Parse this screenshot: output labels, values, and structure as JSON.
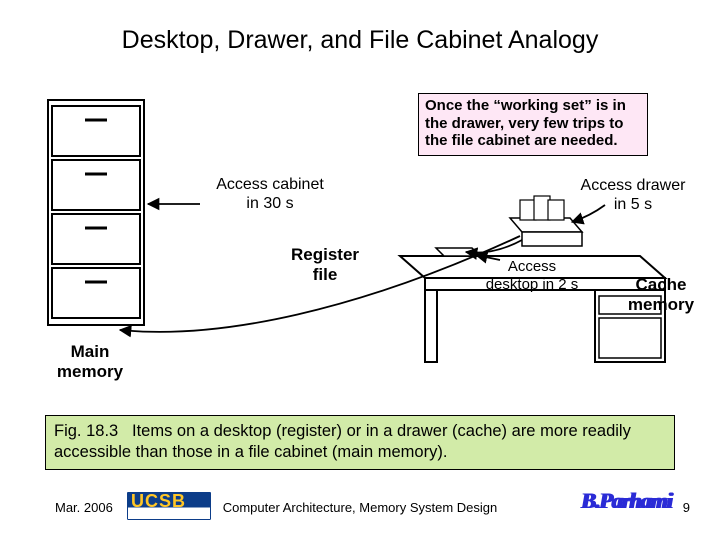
{
  "title": "Desktop, Drawer, and File Cabinet Analogy",
  "callout": "Once the “working set” is in the drawer, very few trips to the file cabinet are needed.",
  "labels": {
    "access_cabinet_l1": "Access cabinet",
    "access_cabinet_l2": "in 30 s",
    "access_drawer_l1": "Access drawer",
    "access_drawer_l2": "in 5 s",
    "access_desktop_l1": "Access",
    "access_desktop_l2": "desktop in 2 s",
    "register_file_l1": "Register",
    "register_file_l2": "file",
    "cache_memory_l1": "Cache",
    "cache_memory_l2": "memory",
    "main_memory_l1": "Main",
    "main_memory_l2": "memory"
  },
  "caption": {
    "fig": "Fig. 18.3",
    "text": "Items on a desktop (register) or in a drawer (cache) are more readily accessible than those in a file cabinet (main memory)."
  },
  "footer": {
    "date": "Mar. 2006",
    "ucsb": "UCSB",
    "mid": "Computer Architecture, Memory System Design",
    "author": "B.Parhami",
    "page": "9"
  }
}
